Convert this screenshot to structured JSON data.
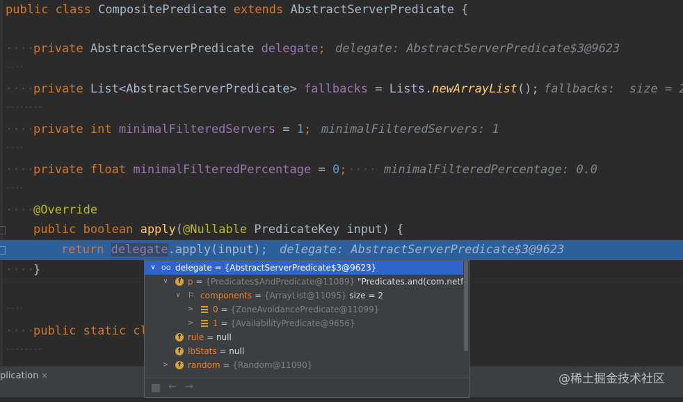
{
  "code": {
    "line1": {
      "kw1": "public",
      "kw2": "class",
      "name": "CompositePredicate",
      "kw3": "extends",
      "parent": "AbstractServerPredicate",
      "brace": "{"
    },
    "line2": {
      "dots": "····",
      "kw": "private",
      "type": "AbstractServerPredicate",
      "field": "delegate",
      "semi": ";",
      "hint": "delegate: AbstractServerPredicate$3@9623"
    },
    "line3": {
      "dots": "····"
    },
    "line4": {
      "dots": "····",
      "kw": "private",
      "type": "List<AbstractServerPredicate>",
      "field": "fallbacks",
      "eq": " = Lists.",
      "method": "newArrayList",
      "rest": "();",
      "hint": "fallbacks:  size = 2"
    },
    "line5": {
      "dots": "········"
    },
    "line6": {
      "dots": "····",
      "kw1": "private",
      "kw2": "int",
      "field": "minimalFilteredServers",
      "eq": " = ",
      "num": "1",
      "semi": ";",
      "hint": "minimalFilteredServers: 1"
    },
    "line7": {
      "dots": "····"
    },
    "line8": {
      "dots": "····",
      "kw1": "private",
      "kw2": "float",
      "field": "minimalFilteredPercentage",
      "eq": " = ",
      "num": "0",
      "semi": ";",
      "dots2": "····",
      "hint": "minimalFilteredPercentage: 0.0"
    },
    "line9": {
      "dots": "····"
    },
    "line10": {
      "dots": "····",
      "ann": "@Override"
    },
    "line11": {
      "kw1": "public",
      "kw2": "boolean",
      "method": "apply",
      "p1": "(",
      "ann": "@Nullable",
      "ptype": " PredicateKey input) {"
    },
    "line12": {
      "kw": "return",
      "field": "delegate",
      "rest": ".apply(input);",
      "hint": "delegate: AbstractServerPredicate$3@9623"
    },
    "line13": {
      "dots": "····",
      "brace": "}"
    },
    "line14": {
      "dots": "····"
    },
    "line15": {
      "dots": "····",
      "kw1": "public",
      "kw2": "static",
      "rest": "cl"
    },
    "line16": {
      "dots": "········"
    }
  },
  "debug_popup": {
    "rows": [
      {
        "arrow": "∨",
        "icon": "glasses-icon",
        "name": "delegate",
        "eq": " = ",
        "type": "{AbstractServerPredicate$3@9623}",
        "value": ""
      },
      {
        "arrow": "∨",
        "icon": "f",
        "name": "p",
        "eq": " = ",
        "type": "{Predicates$AndPredicate@11089}",
        "value": " \"Predicates.and(com.netflix.loa"
      },
      {
        "arrow": "∨",
        "icon": "flag-icon",
        "name": "components",
        "eq": " = ",
        "type": "{ArrayList@11095}",
        "value": "  size = 2"
      },
      {
        "arrow": ">",
        "icon": "list",
        "name": "0",
        "eq": " = ",
        "type": "{ZoneAvoidancePredicate@11099}",
        "value": ""
      },
      {
        "arrow": ">",
        "icon": "list",
        "name": "1",
        "eq": " = ",
        "type": "{AvailabilityPredicate@9656}",
        "value": ""
      },
      {
        "arrow": "",
        "icon": "f",
        "name": "rule",
        "eq": " = ",
        "type": "",
        "value": "null"
      },
      {
        "arrow": "",
        "icon": "f",
        "name": "lbStats",
        "eq": " = ",
        "type": "",
        "value": "null"
      },
      {
        "arrow": ">",
        "icon": "f",
        "name": "random",
        "eq": " = ",
        "type": "{Random@11090}",
        "value": ""
      }
    ],
    "footer": {
      "back": "←",
      "forward": "→"
    }
  },
  "bottom": {
    "tab_label": "plication",
    "tab_close": "×"
  },
  "watermark": "@稀土掘金技术社区"
}
